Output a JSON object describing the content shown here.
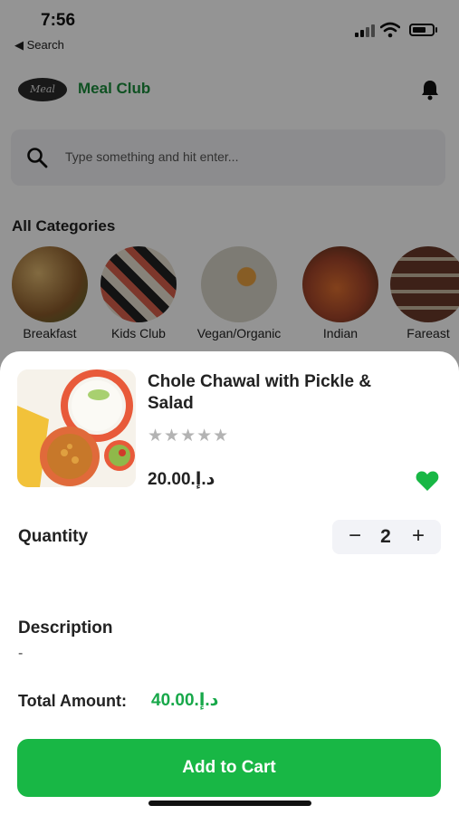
{
  "status_bar": {
    "time": "7:56",
    "back_label": "◀ Search"
  },
  "header": {
    "logo_text": "Meal",
    "app_title": "Meal Club",
    "brand_color": "#1a8c3c"
  },
  "search": {
    "placeholder": "Type something and hit enter..."
  },
  "categories": {
    "heading": "All Categories",
    "items": [
      {
        "label": "Breakfast",
        "color": "#b98a4a"
      },
      {
        "label": "Kids Club",
        "color": "#7a5a4a"
      },
      {
        "label": "Vegan/Organic",
        "color": "#d8d4c8"
      },
      {
        "label": "Indian",
        "color": "#a4452a"
      },
      {
        "label": "Fareast",
        "color": "#6a3a2a"
      }
    ]
  },
  "product": {
    "name": "Chole Chawal with Pickle & Salad",
    "rating": 0,
    "rating_max": 5,
    "stars": "★★★★★",
    "price": "20.00.د.إ",
    "favorited": true
  },
  "quantity": {
    "label": "Quantity",
    "minus": "−",
    "value": "2",
    "plus": "+"
  },
  "description": {
    "label": "Description",
    "value": "-"
  },
  "total": {
    "label": "Total Amount:",
    "value": "40.00.د.إ"
  },
  "cta": {
    "label": "Add to Cart",
    "color": "#18b745"
  }
}
